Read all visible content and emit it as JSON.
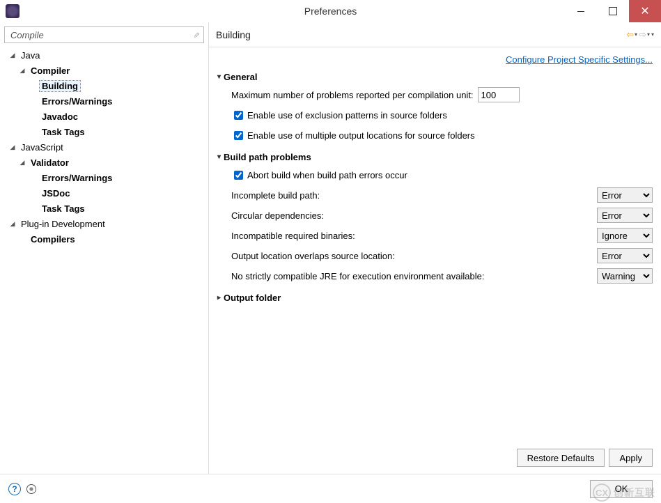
{
  "window": {
    "title": "Preferences"
  },
  "filter": {
    "value": "Compile"
  },
  "tree": {
    "java": "Java",
    "compiler": "Compiler",
    "building": "Building",
    "errors_warnings": "Errors/Warnings",
    "javadoc": "Javadoc",
    "task_tags": "Task Tags",
    "javascript": "JavaScript",
    "validator": "Validator",
    "js_errors_warnings": "Errors/Warnings",
    "jsdoc": "JSDoc",
    "js_task_tags": "Task Tags",
    "plugin_dev": "Plug-in Development",
    "compilers": "Compilers"
  },
  "page": {
    "title": "Building",
    "configure_link": "Configure Project Specific Settings...",
    "sections": {
      "general": {
        "title": "General",
        "max_problems_label": "Maximum number of problems reported per compilation unit:",
        "max_problems_value": "100",
        "exclusion_label": "Enable use of exclusion patterns in source folders",
        "exclusion_checked": true,
        "multiple_output_label": "Enable use of multiple output locations for source folders",
        "multiple_output_checked": true
      },
      "build_path": {
        "title": "Build path problems",
        "abort_label": "Abort build when build path errors occur",
        "abort_checked": true,
        "incomplete_label": "Incomplete build path:",
        "incomplete_value": "Error",
        "circular_label": "Circular dependencies:",
        "circular_value": "Error",
        "incompatible_label": "Incompatible required binaries:",
        "incompatible_value": "Ignore",
        "output_overlap_label": "Output location overlaps source location:",
        "output_overlap_value": "Error",
        "no_jre_label": "No strictly compatible JRE for execution environment available:",
        "no_jre_value": "Warning"
      },
      "output_folder": {
        "title": "Output folder"
      }
    },
    "select_options": [
      "Error",
      "Warning",
      "Ignore"
    ]
  },
  "buttons": {
    "restore": "Restore Defaults",
    "apply": "Apply",
    "ok": "OK"
  },
  "watermark": {
    "badge": "CX",
    "text": "创新互联"
  }
}
